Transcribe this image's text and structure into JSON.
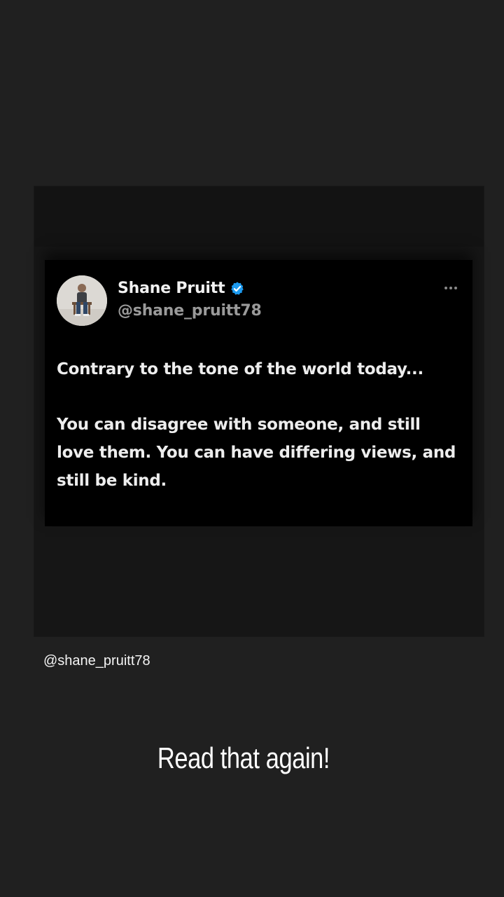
{
  "tweet": {
    "author_name": "Shane Pruitt",
    "author_handle": "@shane_pruitt78",
    "paragraphs": [
      "Contrary to the tone of the world today...",
      "You can disagree with someone, and still love them. You can have differing views, and still be kind."
    ]
  },
  "story": {
    "mention": "@shane_pruitt78",
    "caption": "Read that again!"
  },
  "colors": {
    "background": "#202020",
    "card": "#000000",
    "verified": "#1d9bf0",
    "handle": "#9a9a9a"
  },
  "icons": [
    "verified-badge-icon",
    "more-options-icon"
  ]
}
